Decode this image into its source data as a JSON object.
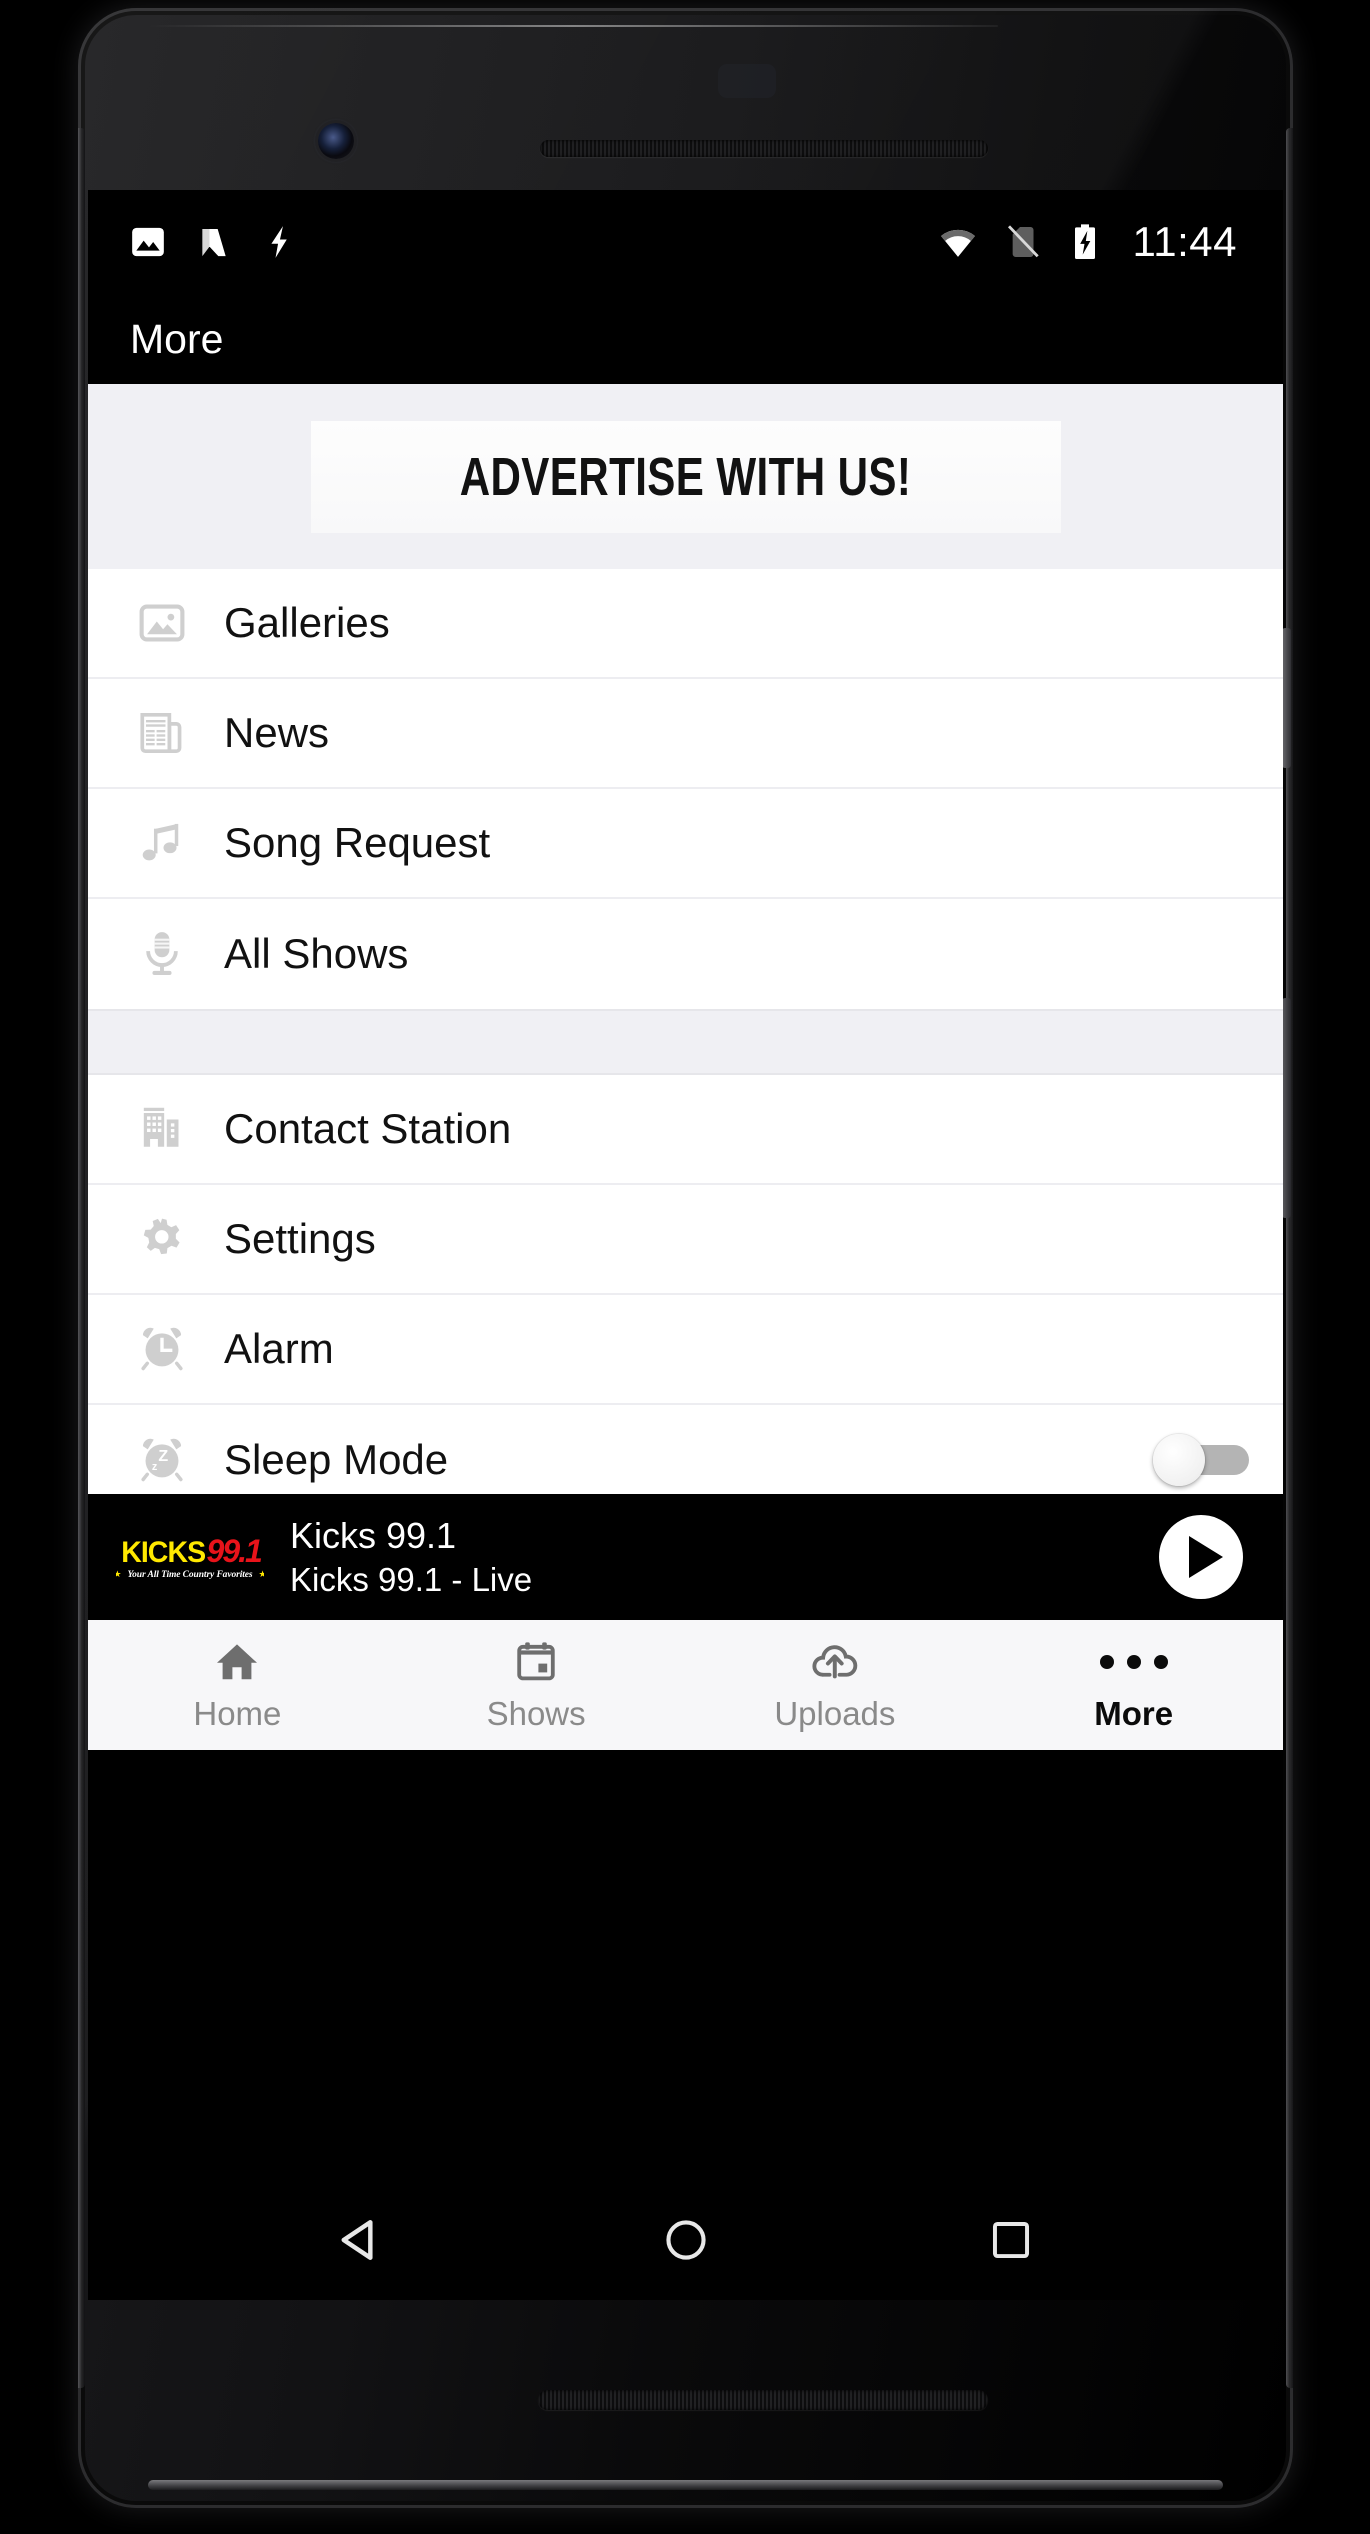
{
  "device": {
    "frame": "android-phone-mockup",
    "camera_icon": "front-camera",
    "earpiece_icon": "earpiece-speaker"
  },
  "status_bar": {
    "left_icons": [
      "screenshot-icon",
      "android-nougat-icon",
      "flash-icon"
    ],
    "right_icons": [
      "wifi-icon",
      "no-sim-icon",
      "battery-charging-icon"
    ],
    "clock": "11:44"
  },
  "app_bar": {
    "title": "More"
  },
  "ad_banner": {
    "text": "ADVERTISE WITH US!",
    "background": "#f0f0f4"
  },
  "menu": {
    "groups": [
      {
        "items": [
          {
            "label": "Galleries",
            "icon": "image-icon"
          },
          {
            "label": "News",
            "icon": "newspaper-icon"
          },
          {
            "label": "Song Request",
            "icon": "music-note-icon"
          },
          {
            "label": "All Shows",
            "icon": "microphone-icon"
          }
        ]
      },
      {
        "items": [
          {
            "label": "Contact Station",
            "icon": "building-icon"
          },
          {
            "label": "Settings",
            "icon": "gear-icon"
          },
          {
            "label": "Alarm",
            "icon": "alarm-clock-icon"
          },
          {
            "label": "Sleep Mode",
            "icon": "sleep-timer-icon",
            "toggle": "off"
          }
        ]
      }
    ]
  },
  "player": {
    "station_name": "Kicks 99.1",
    "now_playing": "Kicks 99.1 - Live",
    "play_button_label": "play-button",
    "logo": {
      "word_mark": "KICKS",
      "frequency": "99.1",
      "tagline": "Your All Time Country Favorites",
      "word_mark_color": "#FFE800",
      "frequency_color": "#E8131A"
    }
  },
  "tab_bar": {
    "items": [
      {
        "label": "Home",
        "icon": "home-icon",
        "active": false
      },
      {
        "label": "Shows",
        "icon": "calendar-icon",
        "active": false
      },
      {
        "label": "Uploads",
        "icon": "cloud-upload-icon",
        "active": false
      },
      {
        "label": "More",
        "icon": "overflow-dots-icon",
        "active": true
      }
    ],
    "active_color": "#0b0b0b",
    "inactive_color": "#8a8a8a"
  },
  "android_nav": {
    "buttons": [
      "back-icon",
      "home-circle-icon",
      "recents-square-icon"
    ]
  }
}
